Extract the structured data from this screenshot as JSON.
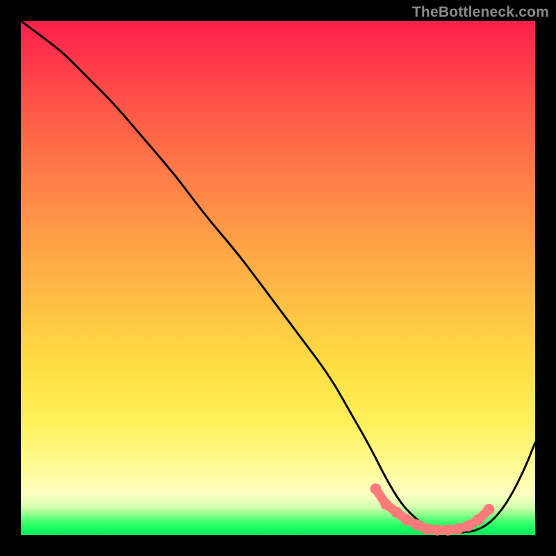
{
  "watermark": "TheBottleneck.com",
  "chart_data": {
    "type": "line",
    "title": "",
    "xlabel": "",
    "ylabel": "",
    "xlim": [
      0,
      100
    ],
    "ylim": [
      0,
      100
    ],
    "grid": false,
    "legend": false,
    "series": [
      {
        "name": "bottleneck-curve",
        "color": "#000000",
        "x": [
          0,
          4,
          8,
          12,
          18,
          24,
          30,
          36,
          42,
          48,
          54,
          60,
          64,
          68,
          71,
          74,
          77,
          80,
          83,
          86,
          89,
          92,
          95,
          98,
          100
        ],
        "y": [
          100,
          97,
          94,
          90,
          84,
          77,
          70,
          62,
          55,
          47,
          39,
          31,
          24,
          17,
          11,
          6,
          3,
          1,
          0.5,
          0.5,
          1,
          3,
          7,
          13,
          18
        ]
      },
      {
        "name": "optimal-zone-markers",
        "color": "#ff7a7a",
        "type": "scatter",
        "x": [
          69,
          71,
          73,
          75,
          77,
          79,
          81,
          83,
          85,
          87,
          89,
          91
        ],
        "y": [
          9,
          6,
          4.5,
          3,
          2,
          1.2,
          1,
          1,
          1.2,
          1.8,
          3,
          5
        ]
      }
    ],
    "annotations": []
  },
  "colors": {
    "gradient_top": "#ff1f4b",
    "gradient_mid": "#ffe044",
    "gradient_bottom": "#06e858",
    "curve": "#000000",
    "markers": "#ff7a7a",
    "frame": "#000000",
    "watermark": "#8b8b8b"
  }
}
